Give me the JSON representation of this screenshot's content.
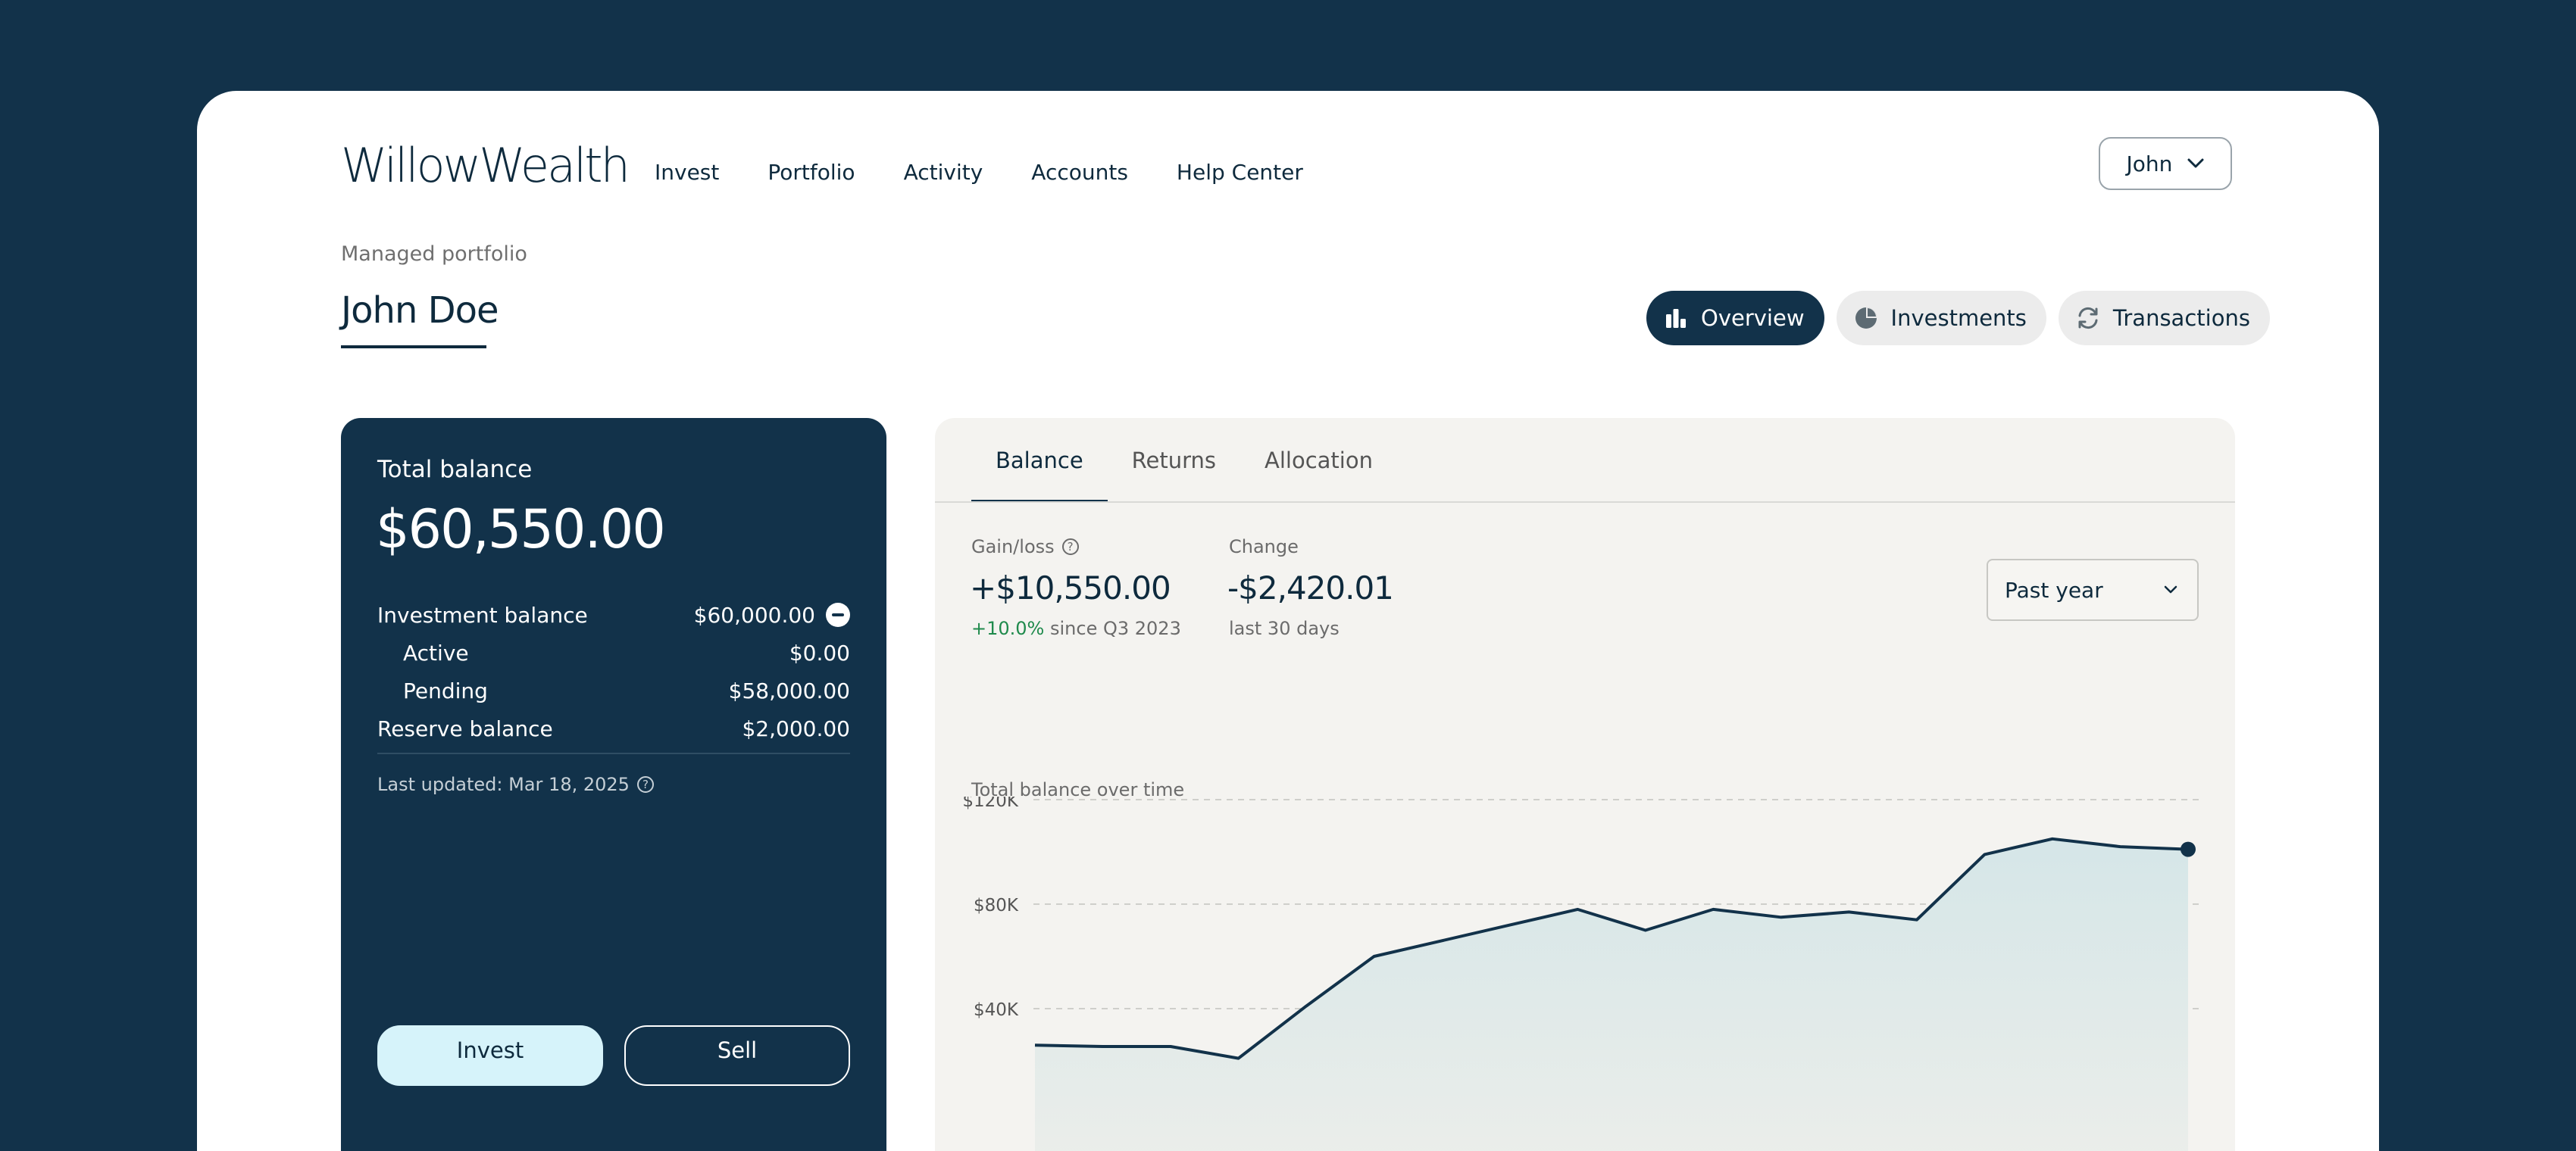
{
  "brand": {
    "name": "WillowWealth"
  },
  "nav": {
    "items": [
      "Invest",
      "Portfolio",
      "Activity",
      "Accounts",
      "Help Center"
    ]
  },
  "user_menu": {
    "label": "John",
    "icon": "chevron-down-icon"
  },
  "page": {
    "subtitle": "Managed portfolio",
    "title": "John Doe"
  },
  "view_tabs": [
    {
      "label": "Overview",
      "icon": "bar-chart-icon",
      "active": true
    },
    {
      "label": "Investments",
      "icon": "pie-chart-icon",
      "active": false
    },
    {
      "label": "Transactions",
      "icon": "refresh-icon",
      "active": false
    }
  ],
  "balance": {
    "label": "Total balance",
    "amount": "$60,550.00",
    "rows": [
      {
        "label": "Investment balance",
        "value": "$60,000.00",
        "icon": "minus-circle-icon"
      },
      {
        "label": "Active",
        "value": "$0.00"
      },
      {
        "label": "Pending",
        "value": "$58,000.00"
      },
      {
        "label": "Reserve balance",
        "value": "$2,000.00"
      }
    ],
    "updated": "Last updated: Mar 18, 2025",
    "invest_label": "Invest",
    "sell_label": "Sell"
  },
  "chart_tabs": [
    {
      "label": "Balance",
      "active": true
    },
    {
      "label": "Returns",
      "active": false
    },
    {
      "label": "Allocation",
      "active": false
    }
  ],
  "stats": {
    "gain": {
      "label": "Gain/loss",
      "value": "+$10,550.00",
      "delta": "+10.0%",
      "note": "since Q3 2023"
    },
    "change": {
      "label": "Change",
      "value": "-$2,420.01",
      "note": "last 30 days"
    }
  },
  "range_select": {
    "value": "Past year"
  },
  "colors": {
    "navy": "#12324a",
    "accent_light": "#d6f3fa",
    "positive": "#1f8a4c",
    "area_fill": "#dce9ea"
  },
  "chart_data": {
    "type": "area",
    "title": "Total balance over time",
    "y_ticks": [
      "$120K",
      "$80K",
      "$40K"
    ],
    "y_tick_values": [
      120000,
      80000,
      40000
    ],
    "ylim": [
      0,
      130000
    ],
    "grid": true,
    "x": [
      0,
      1,
      2,
      3,
      4,
      5,
      6,
      7,
      8,
      9,
      10,
      11,
      12,
      13,
      14,
      15,
      16,
      17
    ],
    "values": [
      26000,
      25500,
      25500,
      21000,
      41000,
      60000,
      66000,
      72000,
      78000,
      70000,
      78000,
      75000,
      77000,
      74000,
      99000,
      105000,
      102000,
      101000
    ]
  }
}
